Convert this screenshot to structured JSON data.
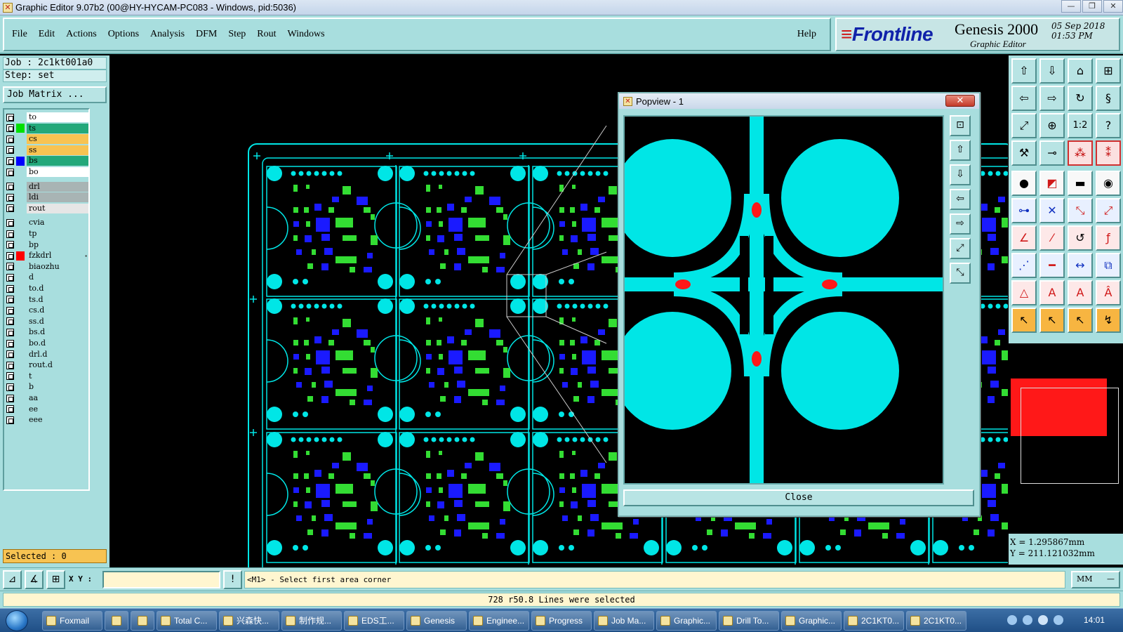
{
  "window": {
    "title": "Graphic Editor 9.07b2 (00@HY-HYCAM-PC083 - Windows, pid:5036)",
    "minimize": "—",
    "restore": "❐",
    "close": "✕"
  },
  "menu": {
    "items": [
      "File",
      "Edit",
      "Actions",
      "Options",
      "Analysis",
      "DFM",
      "Step",
      "Rout",
      "Windows"
    ],
    "help": "Help"
  },
  "brand": {
    "logo": "Frontline",
    "product": "Genesis 2000",
    "subtitle": "Graphic Editor",
    "date_line1": "05 Sep 2018",
    "date_line2": "01:53 PM"
  },
  "job": {
    "job_label": "Job : 2c1kt001a0",
    "step_label": "Step: set",
    "job_matrix": "Job Matrix ..."
  },
  "layers": [
    {
      "name": "to",
      "color": "#ffffff",
      "swatch": ""
    },
    {
      "name": "ts",
      "color": "#23a87a",
      "swatch": "#00e000"
    },
    {
      "name": "cs",
      "color": "#f7c352",
      "swatch": ""
    },
    {
      "name": "ss",
      "color": "#f7c352",
      "swatch": ""
    },
    {
      "name": "bs",
      "color": "#23a87a",
      "swatch": "#0000ff"
    },
    {
      "name": "bo",
      "color": "#ffffff",
      "swatch": ""
    },
    {
      "name": "drl",
      "color": "#a8b4b4",
      "swatch": ""
    },
    {
      "name": "ldi",
      "color": "#a8b4b4",
      "swatch": ""
    },
    {
      "name": "rout",
      "color": "#e6e6e6",
      "swatch": ""
    },
    {
      "name": "cvia",
      "color": "#a8dede",
      "swatch": ""
    },
    {
      "name": "tp",
      "color": "#a8dede",
      "swatch": ""
    },
    {
      "name": "bp",
      "color": "#a8dede",
      "swatch": ""
    },
    {
      "name": "fzkdrl",
      "color": "#a8dede",
      "swatch": "#ff0000"
    },
    {
      "name": "biaozhu",
      "color": "#a8dede",
      "swatch": ""
    },
    {
      "name": "d",
      "color": "#a8dede",
      "swatch": ""
    },
    {
      "name": "to.d",
      "color": "#a8dede",
      "swatch": ""
    },
    {
      "name": "ts.d",
      "color": "#a8dede",
      "swatch": ""
    },
    {
      "name": "cs.d",
      "color": "#a8dede",
      "swatch": ""
    },
    {
      "name": "ss.d",
      "color": "#a8dede",
      "swatch": ""
    },
    {
      "name": "bs.d",
      "color": "#a8dede",
      "swatch": ""
    },
    {
      "name": "bo.d",
      "color": "#a8dede",
      "swatch": ""
    },
    {
      "name": "drl.d",
      "color": "#a8dede",
      "swatch": ""
    },
    {
      "name": "rout.d",
      "color": "#a8dede",
      "swatch": ""
    },
    {
      "name": "t",
      "color": "#a8dede",
      "swatch": ""
    },
    {
      "name": "b",
      "color": "#a8dede",
      "swatch": ""
    },
    {
      "name": "aa",
      "color": "#a8dede",
      "swatch": ""
    },
    {
      "name": "ee",
      "color": "#a8dede",
      "swatch": ""
    },
    {
      "name": "eee",
      "color": "#a8dede",
      "swatch": ""
    }
  ],
  "selected": "Selected : 0",
  "popview": {
    "title": "Popview - 1",
    "close_x": "✕",
    "close_button": "Close"
  },
  "coords": {
    "x": "X = 1.295867mm",
    "y": "Y = 211.121032mm"
  },
  "bottom": {
    "xy_label": "X Y :",
    "xy_value": "",
    "message": "<M1> - Select first area corner",
    "unit": "MM",
    "unit_dash": "—",
    "status": "728 r50.8 Lines were selected"
  },
  "taskbar": {
    "items": [
      "Foxmail",
      "",
      "",
      "Total C...",
      "兴森快...",
      "制作规...",
      "EDS工...",
      "Genesis",
      "Enginee...",
      "Progress",
      "Job Ma...",
      "Graphic...",
      "Drill To...",
      "Graphic...",
      "2C1KT0...",
      "2C1KT0..."
    ],
    "clock": "14:01"
  },
  "colors": {
    "panel": "#a8dede",
    "copper": "#00e6e6",
    "signal_green": "#33dd33",
    "signal_blue": "#1a1aff",
    "highlight_red": "#ff1818",
    "selected_yellow": "#f7c352"
  }
}
